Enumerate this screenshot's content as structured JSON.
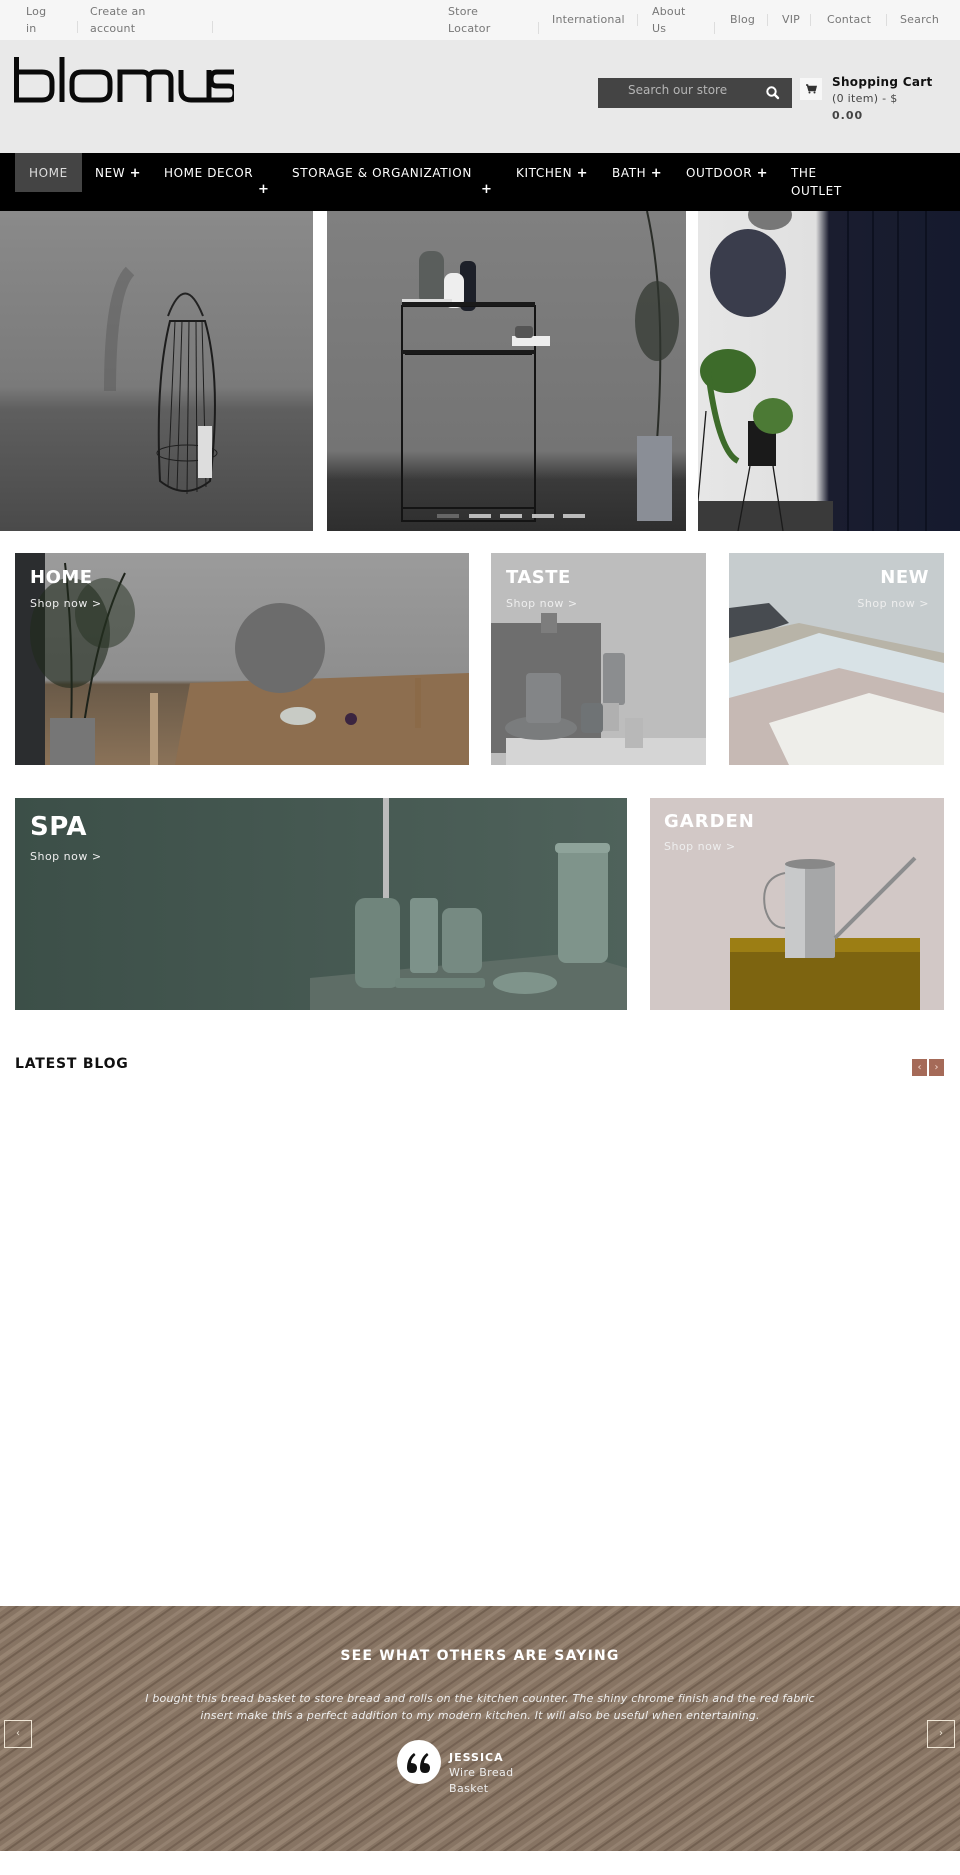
{
  "topbar": {
    "left_links": [
      "Log in",
      "Create an account"
    ],
    "right_links": [
      "Store Locator",
      "International",
      "About Us",
      "Blog",
      "VIP",
      "Contact",
      "Search"
    ]
  },
  "header": {
    "logo_text": "blomus",
    "search": {
      "placeholder": "Search our store",
      "value": ""
    },
    "cart": {
      "title": "Shopping Cart",
      "count_text": "(0 item) - $",
      "total": "0.00"
    }
  },
  "nav": {
    "items": [
      {
        "label": "HOME",
        "active": true,
        "has_submenu": false
      },
      {
        "label": "NEW",
        "has_submenu": true
      },
      {
        "label": "HOME DECOR",
        "has_submenu": true
      },
      {
        "label": "STORAGE & ORGANIZATION",
        "has_submenu": true
      },
      {
        "label": "KITCHEN",
        "has_submenu": true
      },
      {
        "label": "BATH",
        "has_submenu": true
      },
      {
        "label": "OUTDOOR",
        "has_submenu": true
      },
      {
        "label": "THE OUTLET",
        "has_submenu": false
      }
    ],
    "plus_symbol": "+",
    "outlet_line1": "THE",
    "outlet_line2": "OUTLET"
  },
  "hero": {
    "slide_count": 5,
    "active_slide": 1
  },
  "banners": [
    {
      "title": "HOME",
      "link": "Shop now >"
    },
    {
      "title": "TASTE",
      "link": "Shop now >"
    },
    {
      "title": "NEW",
      "link": "Shop now >"
    },
    {
      "title": "SPA",
      "link": "Shop now >"
    },
    {
      "title": "GARDEN",
      "link": "Shop now >"
    }
  ],
  "blog": {
    "title": "LATEST BLOG",
    "prev": "‹",
    "next": "›"
  },
  "testimonial": {
    "title": "SEE WHAT OTHERS ARE SAYING",
    "quote": "I bought this bread basket to store bread and rolls on the kitchen counter. The shiny chrome finish and the red fabric insert make this a perfect addition to my modern kitchen. It will also be useful when entertaining.",
    "name": "JESSICA",
    "product": "Wire Bread Basket",
    "prev": "‹",
    "next": "›"
  },
  "colors": {
    "nav_bg": "#000000",
    "header_bg": "#e9e9e9",
    "topbar_bg": "#f6f6f6",
    "accent_arrows": "#a56a58",
    "search_bg": "#444444"
  }
}
